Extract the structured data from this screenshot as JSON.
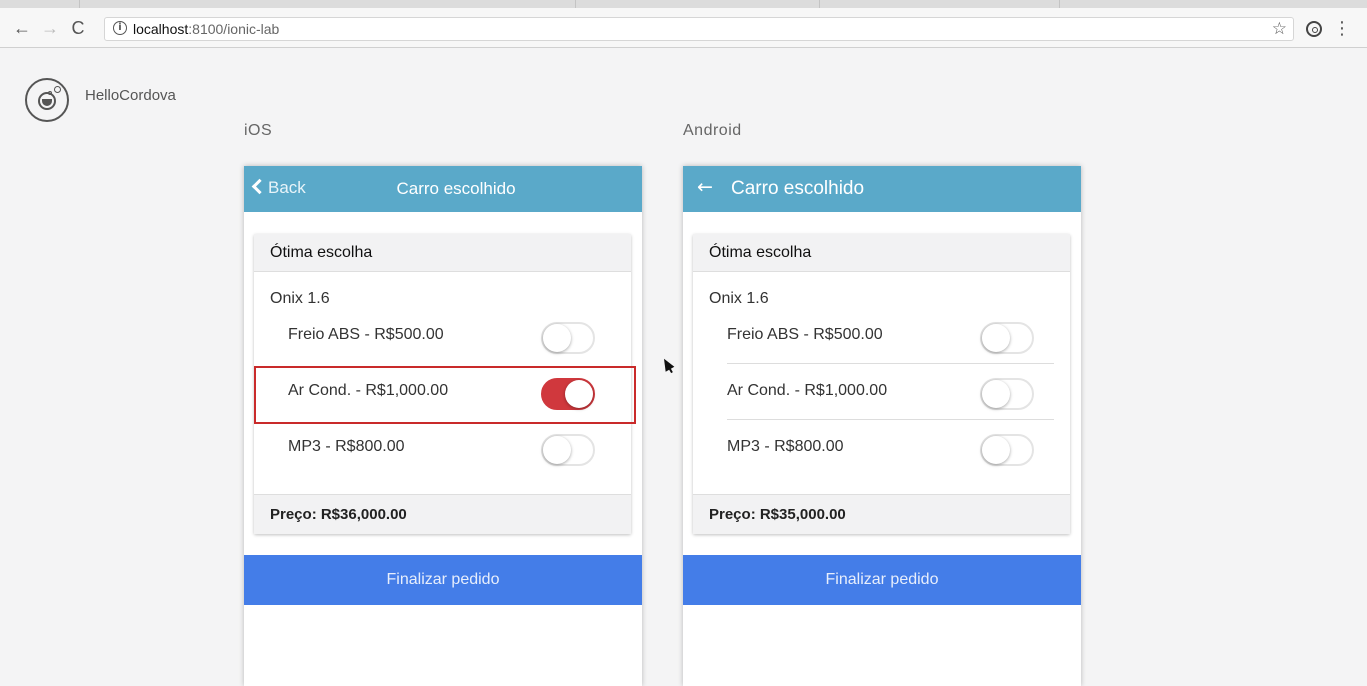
{
  "browser": {
    "url_host": "localhost",
    "url_rest": ":8100/ionic-lab"
  },
  "app": {
    "name": "HelloCordova"
  },
  "platforms": {
    "ios": {
      "label": "iOS",
      "back_label": "Back",
      "title": "Carro escolhido"
    },
    "android": {
      "label": "Android",
      "title": "Carro escolhido"
    }
  },
  "ios_card": {
    "header": "Ótima escolha",
    "car": "Onix 1.6",
    "options": [
      {
        "label": "Freio ABS - R$500.00",
        "checked": false
      },
      {
        "label": "Ar Cond. - R$1,000.00",
        "checked": true
      },
      {
        "label": "MP3 - R$800.00",
        "checked": false
      }
    ],
    "price": "Preço: R$36,000.00",
    "button": "Finalizar pedido"
  },
  "android_card": {
    "header": "Ótima escolha",
    "car": "Onix 1.6",
    "options": [
      {
        "label": "Freio ABS - R$500.00",
        "checked": false
      },
      {
        "label": "Ar Cond. - R$1,000.00",
        "checked": false
      },
      {
        "label": "MP3 - R$800.00",
        "checked": false
      }
    ],
    "price": "Preço: R$35,000.00",
    "button": "Finalizar pedido"
  },
  "colors": {
    "navbar": "#5aa9c9",
    "toggle_on": "#d0383d",
    "primary_button": "#447de8",
    "highlight": "#c92a2a"
  }
}
